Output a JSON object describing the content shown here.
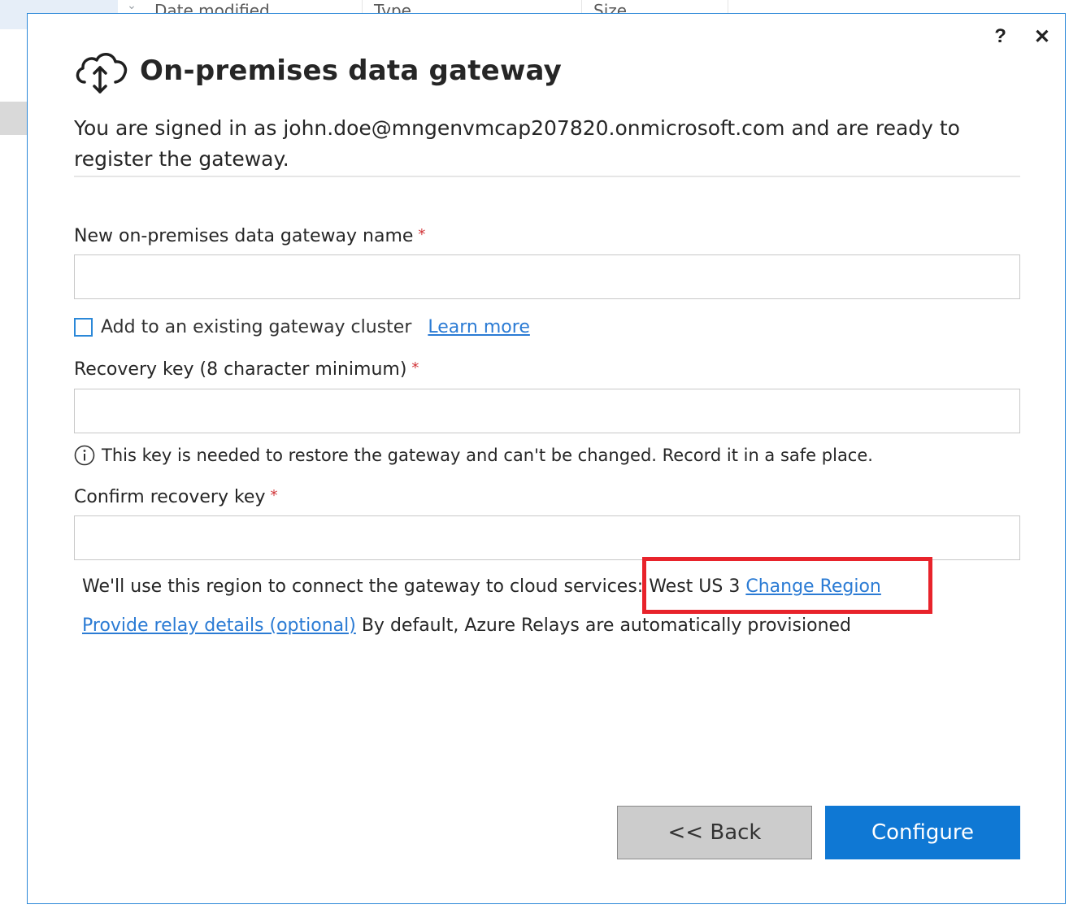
{
  "background": {
    "columns": [
      "Date modified",
      "Type",
      "Size"
    ],
    "chevron": "⌄"
  },
  "dialog": {
    "help_label": "?",
    "close_label": "✕",
    "title": "On-premises data gateway",
    "signed_in_text": "You are signed in as john.doe@mngenvmcap207820.onmicrosoft.com and are ready to register the gateway.",
    "gateway_name": {
      "label": "New on-premises data gateway name",
      "required": "*",
      "value": ""
    },
    "cluster_checkbox": {
      "label": "Add to an existing gateway cluster",
      "checked": false,
      "learn_more": "Learn more"
    },
    "recovery_key": {
      "label": "Recovery key (8 character minimum)",
      "required": "*",
      "value": ""
    },
    "info_text": "This key is needed to restore the gateway and can't be changed. Record it in a safe place.",
    "confirm_key": {
      "label": "Confirm recovery key",
      "required": "*",
      "value": ""
    },
    "region": {
      "text_prefix": "We'll use this region to connect the gateway to cloud services: ",
      "region_name": "West US 3",
      "change_link": "Change Region"
    },
    "relay": {
      "link": "Provide relay details (optional)",
      "text": " By default, Azure Relays are automatically provisioned"
    },
    "buttons": {
      "back": "<< Back",
      "configure": "Configure"
    }
  },
  "colors": {
    "accent": "#0f78d4",
    "border": "#2b88d8",
    "link": "#2b7bd4",
    "required": "#d13438",
    "highlight": "#e8232b"
  }
}
